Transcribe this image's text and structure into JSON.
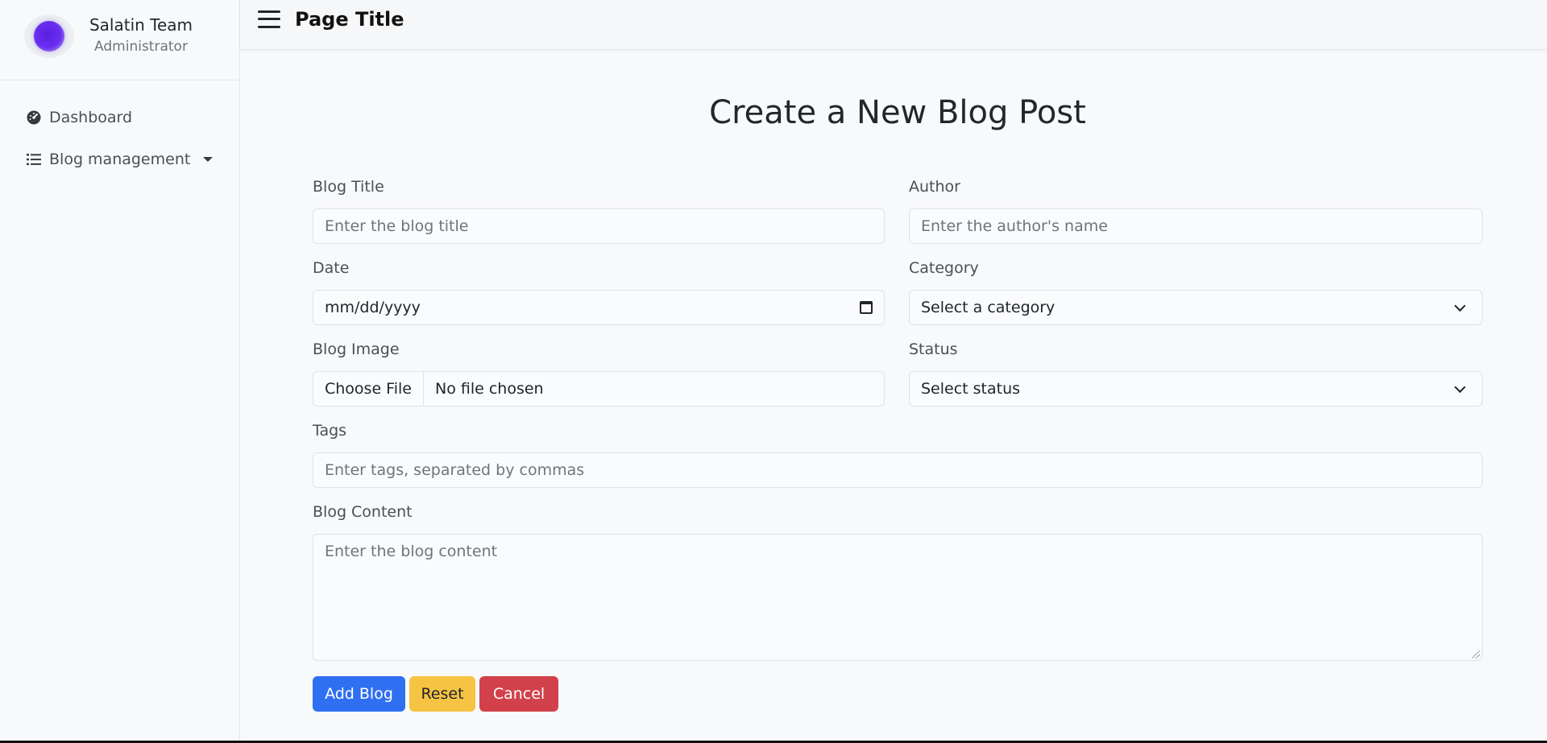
{
  "sidebar": {
    "profile": {
      "name": "Salatin Team",
      "role": "Administrator"
    },
    "items": [
      {
        "label": "Dashboard",
        "icon": "dashboard-icon"
      },
      {
        "label": "Blog management",
        "icon": "list-icon",
        "has_dropdown": true
      }
    ]
  },
  "header": {
    "title": "Page Title"
  },
  "form": {
    "heading": "Create a New Blog Post",
    "fields": {
      "title": {
        "label": "Blog Title",
        "placeholder": "Enter the blog title"
      },
      "author": {
        "label": "Author",
        "placeholder": "Enter the author's name"
      },
      "date": {
        "label": "Date",
        "placeholder": "mm/dd/yyyy"
      },
      "category": {
        "label": "Category",
        "selected": "Select a category"
      },
      "image": {
        "label": "Blog Image",
        "button": "Choose File",
        "status": "No file chosen"
      },
      "status": {
        "label": "Status",
        "selected": "Select status"
      },
      "tags": {
        "label": "Tags",
        "placeholder": "Enter tags, separated by commas"
      },
      "content": {
        "label": "Blog Content",
        "placeholder": "Enter the blog content"
      }
    },
    "buttons": {
      "add": "Add Blog",
      "reset": "Reset",
      "cancel": "Cancel"
    }
  },
  "colors": {
    "primary": "#2f6ff2",
    "warning": "#f6c343",
    "danger": "#d2414b",
    "avatar": "#5a1fe0"
  }
}
